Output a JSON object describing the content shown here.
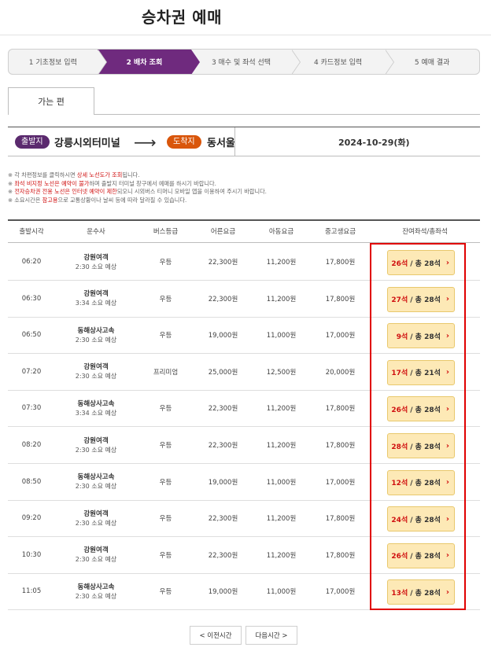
{
  "page_title": "승차권 예매",
  "steps": [
    {
      "label": "1 기초정보 입력",
      "active": false
    },
    {
      "label": "2 배차 조회",
      "active": true
    },
    {
      "label": "3 매수 및 좌석 선택",
      "active": false
    },
    {
      "label": "4 카드정보 입력",
      "active": false
    },
    {
      "label": "5 예매 결과",
      "active": false
    }
  ],
  "tab": {
    "label": "가는 편"
  },
  "route": {
    "departure_badge": "출발지",
    "departure": "강릉시외터미널",
    "arrow": "⟶",
    "arrival_badge": "도착지",
    "arrival": "동서울",
    "date": "2024-10-29(화)"
  },
  "notices": [
    {
      "prefix": "※ 각 차편정보를 클릭하시면 ",
      "red": "상세 노선도가 조회",
      "suffix": "됩니다."
    },
    {
      "prefix": "※ ",
      "red": "좌석 비지정 노선은 예약이 불가",
      "suffix": "하며 출발지 터미널 창구에서 예매를 하시기 바랍니다."
    },
    {
      "prefix": "※ ",
      "red": "전자승차권 전용 노선은 인터넷 예약이 제한",
      "suffix": "되오니 시외버스 티머니 모바일 앱을 이용하여 주시기 바랍니다."
    },
    {
      "prefix": "※ 소요시간은 ",
      "red": "참고용",
      "suffix": "으로 교통상황이나 날씨 등에 따라 달라질 수 있습니다."
    }
  ],
  "table": {
    "headers": [
      "출발시각",
      "운수사",
      "버스등급",
      "어른요금",
      "아동요금",
      "중고생요금",
      "잔여좌석/총좌석"
    ],
    "rows": [
      {
        "time": "06:20",
        "company": "강원여객",
        "duration": "2:30 소요 예상",
        "grade": "우등",
        "adult": "22,300원",
        "child": "11,200원",
        "student": "17,800원",
        "remain": "26석",
        "total": "/ 총 28석"
      },
      {
        "time": "06:30",
        "company": "강원여객",
        "duration": "3:34 소요 예상",
        "grade": "우등",
        "adult": "22,300원",
        "child": "11,200원",
        "student": "17,800원",
        "remain": "27석",
        "total": "/ 총 28석"
      },
      {
        "time": "06:50",
        "company": "동해상사고속",
        "duration": "2:30 소요 예상",
        "grade": "우등",
        "adult": "19,000원",
        "child": "11,000원",
        "student": "17,000원",
        "remain": "9석",
        "total": "/ 총 28석"
      },
      {
        "time": "07:20",
        "company": "강원여객",
        "duration": "2:30 소요 예상",
        "grade": "프리미엄",
        "adult": "25,000원",
        "child": "12,500원",
        "student": "20,000원",
        "remain": "17석",
        "total": "/ 총 21석"
      },
      {
        "time": "07:30",
        "company": "동해상사고속",
        "duration": "3:34 소요 예상",
        "grade": "우등",
        "adult": "22,300원",
        "child": "11,200원",
        "student": "17,800원",
        "remain": "26석",
        "total": "/ 총 28석"
      },
      {
        "time": "08:20",
        "company": "강원여객",
        "duration": "2:30 소요 예상",
        "grade": "우등",
        "adult": "22,300원",
        "child": "11,200원",
        "student": "17,800원",
        "remain": "28석",
        "total": "/ 총 28석"
      },
      {
        "time": "08:50",
        "company": "동해상사고속",
        "duration": "2:30 소요 예상",
        "grade": "우등",
        "adult": "19,000원",
        "child": "11,000원",
        "student": "17,000원",
        "remain": "12석",
        "total": "/ 총 28석"
      },
      {
        "time": "09:20",
        "company": "강원여객",
        "duration": "2:30 소요 예상",
        "grade": "우등",
        "adult": "22,300원",
        "child": "11,200원",
        "student": "17,800원",
        "remain": "24석",
        "total": "/ 총 28석"
      },
      {
        "time": "10:30",
        "company": "강원여객",
        "duration": "2:30 소요 예상",
        "grade": "우등",
        "adult": "22,300원",
        "child": "11,200원",
        "student": "17,800원",
        "remain": "26석",
        "total": "/ 총 28석"
      },
      {
        "time": "11:05",
        "company": "동해상사고속",
        "duration": "2:30 소요 예상",
        "grade": "우등",
        "adult": "19,000원",
        "child": "11,000원",
        "student": "17,000원",
        "remain": "13석",
        "total": "/ 총 28석"
      }
    ]
  },
  "pager": {
    "prev": "< 이전시간",
    "next": "다음시간 >"
  },
  "colors": {
    "primary": "#6f2a7e",
    "departure_badge": "#5b2a6e",
    "arrival_badge": "#d9560b",
    "seat_button_bg": "#fde9b6",
    "highlight": "#e00000",
    "remain_text": "#d01010"
  },
  "icons": {
    "route_arrow": "arrow-right-icon",
    "seat_caret": "chevron-right-icon"
  }
}
